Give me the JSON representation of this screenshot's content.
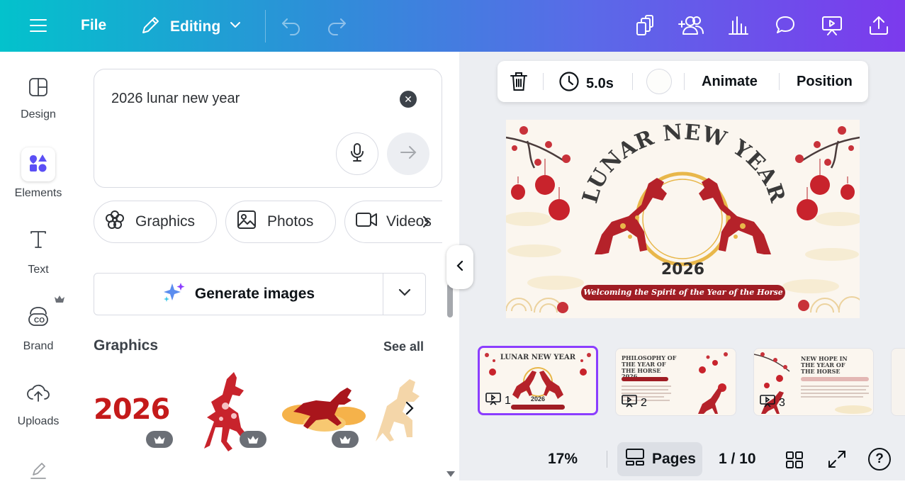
{
  "topbar": {
    "file_label": "File",
    "mode_label": "Editing"
  },
  "rail": {
    "items": [
      {
        "label": "Design"
      },
      {
        "label": "Elements"
      },
      {
        "label": "Text"
      },
      {
        "label": "Brand"
      },
      {
        "label": "Uploads"
      }
    ]
  },
  "panel": {
    "search_value": "2026 lunar new year",
    "chips": [
      "Graphics",
      "Photos",
      "Videos"
    ],
    "generate_label": "Generate images",
    "section_title": "Graphics",
    "see_all": "See all",
    "graphic_2026_text": "2026"
  },
  "context_bar": {
    "duration": "5.0s",
    "animate": "Animate",
    "position": "Position"
  },
  "design": {
    "title": "LUNAR NEW YEAR",
    "year": "2026",
    "banner": "Welcoming the Spirit of the Year of the Horse"
  },
  "thumbnails": [
    {
      "num": "1",
      "title": "LUNAR NEW YEAR",
      "year": "2026"
    },
    {
      "num": "2",
      "title": "PHILOSOPHY OF THE YEAR OF THE HORSE 2026"
    },
    {
      "num": "3",
      "title": "NEW HOPE IN THE YEAR OF THE HORSE"
    }
  ],
  "bottom": {
    "zoom": "17%",
    "pages_label": "Pages",
    "page_count": "1 / 10"
  },
  "colors": {
    "accent": "#8b3dff",
    "horse_red": "#b5222a",
    "gold": "#e8b74a"
  }
}
